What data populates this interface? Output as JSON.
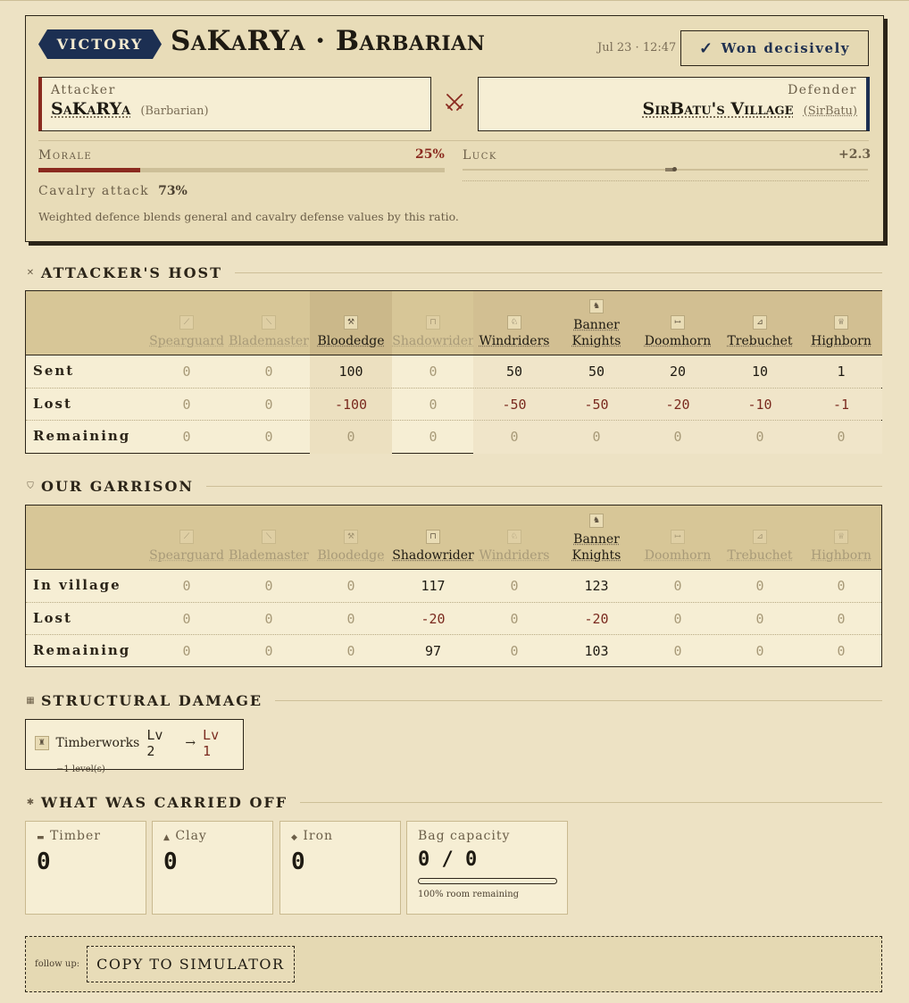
{
  "header": {
    "badge": "VICTORY",
    "title": "SaKaRYa · Barbarian",
    "timestamp": "Jul 23 · 12:47",
    "outcome": "Won decisively"
  },
  "attacker": {
    "role": "Attacker",
    "name": "SaKaRYa",
    "tribe": "(Barbarian)"
  },
  "defender": {
    "role": "Defender",
    "name": "SirBatu's Village",
    "owner": "(SirBatu)"
  },
  "morale": {
    "label": "Morale",
    "value": "25%",
    "fraction": 0.25
  },
  "luck": {
    "label": "Luck",
    "value": "+2.3",
    "fraction": 0.023
  },
  "cavalry": {
    "label": "Cavalry attack",
    "value": "73%",
    "note": "Weighted defence blends general and cavalry defense values by this ratio."
  },
  "sections": {
    "attackers_host": "ATTACKER'S HOST",
    "our_garrison": "OUR GARRISON",
    "structural": "STRUCTURAL DAMAGE",
    "carried": "WHAT WAS CARRIED OFF"
  },
  "units": [
    {
      "name": "Spearguard",
      "icon": "spear-icon",
      "glyph": "⟋"
    },
    {
      "name": "Blademaster",
      "icon": "sword-icon",
      "glyph": "⟍"
    },
    {
      "name": "Bloodedge",
      "icon": "axe-icon",
      "glyph": "⚒"
    },
    {
      "name": "Shadowrider",
      "icon": "banner-icon",
      "glyph": "⊓"
    },
    {
      "name": "Windriders",
      "icon": "horse-icon",
      "glyph": "♘"
    },
    {
      "name": "Banner Knights",
      "icon": "knight-icon",
      "glyph": "♞"
    },
    {
      "name": "Doomhorn",
      "icon": "ram-icon",
      "glyph": "↦"
    },
    {
      "name": "Trebuchet",
      "icon": "catapult-icon",
      "glyph": "⊿"
    },
    {
      "name": "Highborn",
      "icon": "crown-icon",
      "glyph": "♕"
    }
  ],
  "attack_table": {
    "active": [
      false,
      false,
      true,
      false,
      true,
      true,
      true,
      true,
      true
    ],
    "rows": [
      {
        "label": "Sent",
        "values": [
          "0",
          "0",
          "100",
          "0",
          "50",
          "50",
          "20",
          "10",
          "1"
        ]
      },
      {
        "label": "Lost",
        "values": [
          "0",
          "0",
          "-100",
          "0",
          "-50",
          "-50",
          "-20",
          "-10",
          "-1"
        ]
      },
      {
        "label": "Remaining",
        "values": [
          "0",
          "0",
          "0",
          "0",
          "0",
          "0",
          "0",
          "0",
          "0"
        ]
      }
    ]
  },
  "garrison_table": {
    "active": [
      false,
      false,
      false,
      true,
      false,
      true,
      false,
      false,
      false
    ],
    "rows": [
      {
        "label": "In village",
        "values": [
          "0",
          "0",
          "0",
          "117",
          "0",
          "123",
          "0",
          "0",
          "0"
        ]
      },
      {
        "label": "Lost",
        "values": [
          "0",
          "0",
          "0",
          "-20",
          "0",
          "-20",
          "0",
          "0",
          "0"
        ]
      },
      {
        "label": "Remaining",
        "values": [
          "0",
          "0",
          "0",
          "97",
          "0",
          "103",
          "0",
          "0",
          "0"
        ]
      }
    ]
  },
  "structural": {
    "building": "Timberworks",
    "from": "Lv 2",
    "arrow": "→",
    "to": "Lv 1",
    "note": "−1 level(s)"
  },
  "loot": {
    "timber": {
      "label": "Timber",
      "value": "0"
    },
    "clay": {
      "label": "Clay",
      "value": "0"
    },
    "iron": {
      "label": "Iron",
      "value": "0"
    },
    "capacity": {
      "label": "Bag capacity",
      "value": "0 / 0",
      "note": "100% room remaining",
      "fraction": 0
    }
  },
  "follow_up": {
    "label": "follow up:",
    "button": "COPY TO SIMULATOR"
  },
  "colors": {
    "navy": "#1c2f52",
    "crimson": "#8a2a1f",
    "parchment": "#ede2c4"
  }
}
